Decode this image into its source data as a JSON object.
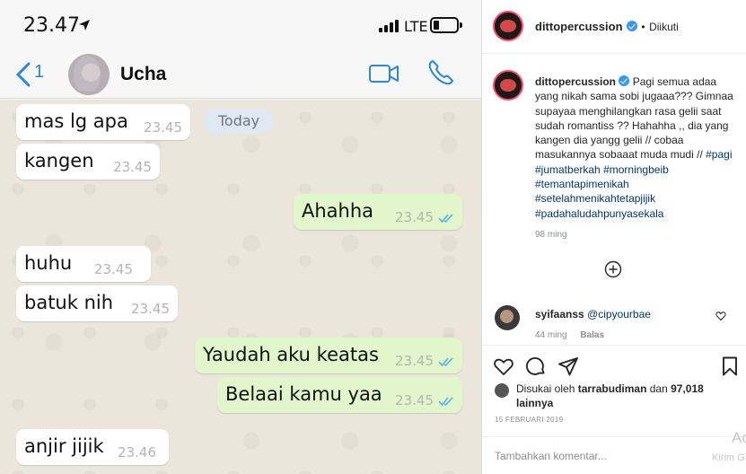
{
  "phone": {
    "status_time": "23.47",
    "network": "LTE",
    "back_count": "1",
    "contact_name": "Ucha",
    "date_label": "Today",
    "messages": [
      {
        "text": "mas lg apa",
        "time": "23.45",
        "direction": "in",
        "read": false
      },
      {
        "text": "kangen",
        "time": "23.45",
        "direction": "in",
        "read": false
      },
      {
        "text": "Ahahha",
        "time": "23.45",
        "direction": "out",
        "read": true
      },
      {
        "text": "huhu",
        "time": "23.45",
        "direction": "in",
        "read": false
      },
      {
        "text": "batuk nih",
        "time": "23.45",
        "direction": "in",
        "read": false
      },
      {
        "text": "Yaudah aku keatas",
        "time": "23.45",
        "direction": "out",
        "read": true
      },
      {
        "text": "Belaai kamu yaa",
        "time": "23.45",
        "direction": "out",
        "read": true
      },
      {
        "text": "anjir jijik",
        "time": "23.46",
        "direction": "in",
        "read": false
      }
    ],
    "colors": {
      "accent": "#2a86d9",
      "outgoing_bubble": "#e1f7cb",
      "incoming_bubble": "#ffffff",
      "tick": "#4fb3f0"
    }
  },
  "instagram": {
    "header": {
      "username": "dittopercussion",
      "separator": "•",
      "follow_status": "Diikuti"
    },
    "caption": {
      "username": "dittopercussion",
      "text": "Pagi semua adaa yang nikah sama sobi jugaaa??? Gimnaa supayaa menghilangkan rasa gelii saat sudah romantiss ?? Hahahha ,, dia yang kangen dia yangg gelii // cobaa masukannya sobaaat muda mudi //",
      "hashtags": [
        "#pagi",
        "#jumatberkah",
        "#morningbeib",
        "#temantapimenikah",
        "#setelahmenikahtetapjijik",
        "#padahaludahpunyasekala"
      ],
      "time_ago": "98 ming"
    },
    "comment": {
      "username": "syifaanss",
      "mention": "@cipyourbae",
      "time_ago": "44 ming",
      "reply_label": "Balas"
    },
    "likes": {
      "prefix": "Disukai oleh",
      "liker": "tarrabudiman",
      "middle": "dan",
      "count": "97,018",
      "suffix": "lainnya"
    },
    "post_date": "15 FEBRUARI 2019",
    "add_comment_placeholder": "Tambahkan komentar...",
    "watermark": {
      "line1": "Ac",
      "line2": "Kirim G"
    },
    "icons": [
      "heart-icon",
      "comment-icon",
      "share-icon",
      "bookmark-icon",
      "plus-circle-icon",
      "verified-icon"
    ]
  }
}
